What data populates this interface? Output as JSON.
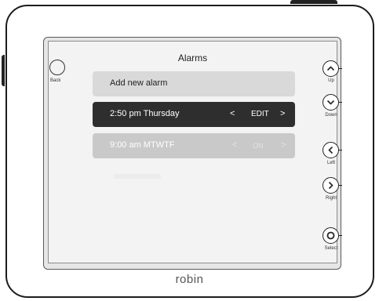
{
  "screen": {
    "title": "Alarms",
    "back_label": "Back"
  },
  "alarms": {
    "add_new": "Add new alarm",
    "items": [
      {
        "time": "2:50 pm Thursday",
        "prev": "<",
        "action": "EDIT",
        "next": ">",
        "selected": true
      },
      {
        "time": "9:00 am MTWTF",
        "prev": "<",
        "action": "ON",
        "next": ">",
        "selected": false
      }
    ]
  },
  "side_buttons": {
    "up": "Up",
    "down": "Down",
    "left": "Left",
    "right": "Right",
    "select": "Select"
  },
  "brand": "robin"
}
